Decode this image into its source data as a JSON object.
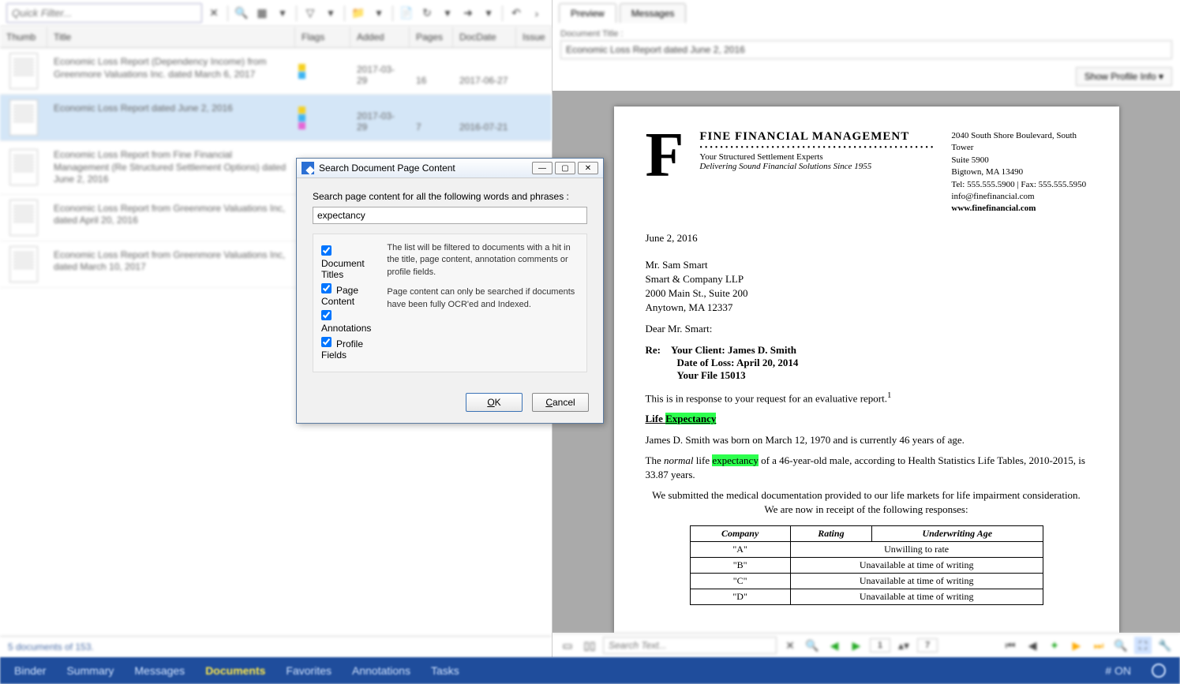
{
  "toolbar": {
    "quick_filter_placeholder": "Quick Filter..."
  },
  "columns": {
    "thumb": "Thumb",
    "title": "Title",
    "flags": "Flags",
    "added": "Added",
    "pages": "Pages",
    "docdate": "DocDate",
    "issue": "Issue"
  },
  "docs": [
    {
      "title": "Economic Loss Report (Dependency Income) from Greenmore Valuations Inc. dated March 6, 2017",
      "added": "2017-03-29",
      "pages": "16",
      "docdate": "2017-06-27",
      "issue": ""
    },
    {
      "title": "Economic Loss Report dated June 2, 2016",
      "added": "2017-03-29",
      "pages": "7",
      "docdate": "2016-07-21",
      "issue": ""
    },
    {
      "title": "Economic Loss Report from Fine Financial Management (Re Structured Settlement Options) dated June 2, 2016",
      "added": "",
      "pages": "",
      "docdate": "",
      "issue": ""
    },
    {
      "title": "Economic Loss Report from Greenmore Valuations Inc, dated April 20, 2016",
      "added": "",
      "pages": "",
      "docdate": "",
      "issue": ""
    },
    {
      "title": "Economic Loss Report from Greenmore Valuations Inc, dated March 10, 2017",
      "added": "",
      "pages": "",
      "docdate": "",
      "issue": ""
    }
  ],
  "status_left": "5 documents of 153.",
  "right_tabs": {
    "preview": "Preview",
    "messages": "Messages"
  },
  "doc_title_label": "Document Title :",
  "doc_title_value": "Economic Loss Report dated June 2, 2016",
  "profile_btn": "Show Profile Info  ▾",
  "letter": {
    "company": "FINE FINANCIAL MANAGEMENT",
    "tag1": "Your Structured Settlement Experts",
    "tag2": "Delivering Sound Financial Solutions Since 1955",
    "addr1": "2040 South Shore Boulevard, South Tower",
    "addr2": "Suite 5900",
    "addr3": "Bigtown, MA 13490",
    "tel": "Tel: 555.555.5900   |   Fax: 555.555.5950",
    "email": "info@finefinancial.com",
    "web": "www.finefinancial.com",
    "date": "June 2, 2016",
    "to1": "Mr. Sam Smart",
    "to2": "Smart & Company LLP",
    "to3": "2000 Main St., Suite 200",
    "to4": "Anytown, MA 12337",
    "salutation": "Dear Mr. Smart:",
    "re_label": "Re:",
    "re1": "Your Client:  James D. Smith",
    "re2": "Date of Loss: April 20, 2014",
    "re3": "Your File 15013",
    "p1": "This is in response to your request for an evaluative report.",
    "sup1": "1",
    "h_life": "Life ",
    "h_exp": "Expectancy",
    "p2": "James D. Smith was born on March 12, 1970 and is currently 46 years of age.",
    "p3a": "The ",
    "p3_normal": "normal",
    "p3b": " life ",
    "p3_hl": "expectancy",
    "p3c": " of a 46-year-old male, according to Health Statistics Life Tables, 2010-2015, is 33.87 years.",
    "p4": "We submitted the medical documentation provided to our life markets for life impairment consideration. We are now in receipt of the following responses:",
    "tbl_h1": "Company",
    "tbl_h2": "Rating",
    "tbl_h3": "Underwriting Age",
    "rows": [
      {
        "c": "\"A\"",
        "r": "Unwilling to rate",
        "u": ""
      },
      {
        "c": "\"B\"",
        "r": "Unavailable at time of writing",
        "u": ""
      },
      {
        "c": "\"C\"",
        "r": "Unavailable at time of writing",
        "u": ""
      },
      {
        "c": "\"D\"",
        "r": "Unavailable at time of writing",
        "u": ""
      }
    ]
  },
  "preview_bottom": {
    "search_placeholder": "Search Text...",
    "page": "1",
    "total": "7"
  },
  "dialog": {
    "title": "Search Document Page Content",
    "prompt": "Search page content for all the following words and phrases :",
    "value": "expectancy",
    "chk_titles": "Document Titles",
    "chk_content": "Page Content",
    "chk_annot": "Annotations",
    "chk_profile": "Profile Fields",
    "hint1": "The list will be filtered to documents with a hit in the title, page content, annotation comments or profile fields.",
    "hint2": "Page content can only be searched if documents have been fully OCR'ed and Indexed.",
    "ok": "OK",
    "cancel": "Cancel"
  },
  "nav": {
    "binder": "Binder",
    "summary": "Summary",
    "messages": "Messages",
    "documents": "Documents",
    "favorites": "Favorites",
    "annotations": "Annotations",
    "tasks": "Tasks",
    "status": "# ON"
  }
}
